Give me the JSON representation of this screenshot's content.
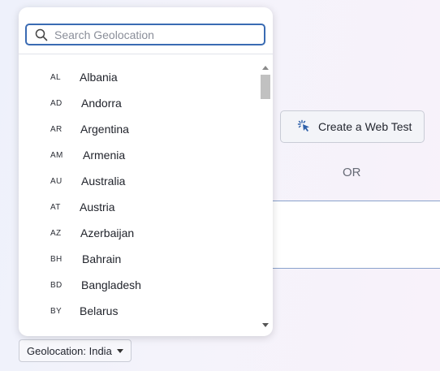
{
  "background": {
    "create_web_test_label": "Create a Web Test",
    "or_label": "OR"
  },
  "geolocation": {
    "trigger_label": "Geolocation: India",
    "search_placeholder": "Search Geolocation",
    "countries": [
      {
        "code": "AL",
        "name": "Albania"
      },
      {
        "code": "AD",
        "name": "Andorra"
      },
      {
        "code": "AR",
        "name": "Argentina"
      },
      {
        "code": "AM",
        "name": "Armenia"
      },
      {
        "code": "AU",
        "name": "Australia"
      },
      {
        "code": "AT",
        "name": "Austria"
      },
      {
        "code": "AZ",
        "name": "Azerbaijan"
      },
      {
        "code": "BH",
        "name": "Bahrain"
      },
      {
        "code": "BD",
        "name": "Bangladesh"
      },
      {
        "code": "BY",
        "name": "Belarus"
      }
    ]
  },
  "icons": {
    "search": "search-icon",
    "web_test": "cursor-click-icon",
    "caret": "caret-down-icon"
  },
  "colors": {
    "accent": "#3a6bb3",
    "icon_blue": "#2d5fa8"
  }
}
